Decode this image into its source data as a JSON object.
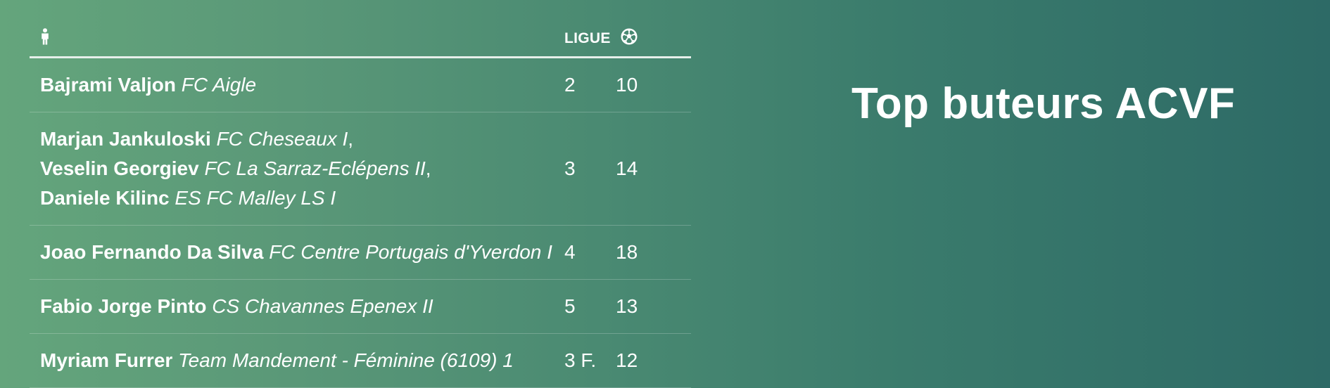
{
  "title": "Top buteurs ACVF",
  "table": {
    "headers": {
      "player_icon": "person-icon",
      "league": "LIGUE",
      "goals_icon": "soccer-ball-icon"
    },
    "rows": [
      {
        "scorers": [
          {
            "name": "Bajrami Valjon",
            "club": "FC Aigle"
          }
        ],
        "league": "2",
        "goals": "10"
      },
      {
        "scorers": [
          {
            "name": "Marjan Jankuloski",
            "club": "FC Cheseaux I"
          },
          {
            "name": "Veselin Georgiev",
            "club": "FC La Sarraz-Eclépens II"
          },
          {
            "name": "Daniele Kilinc",
            "club": "ES FC Malley LS I"
          }
        ],
        "league": "3",
        "goals": "14"
      },
      {
        "scorers": [
          {
            "name": "Joao Fernando Da Silva",
            "club": "FC Centre Portugais d'Yverdon I"
          }
        ],
        "league": "4",
        "goals": "18"
      },
      {
        "scorers": [
          {
            "name": "Fabio Jorge Pinto",
            "club": "CS Chavannes Epenex II"
          }
        ],
        "league": "5",
        "goals": "13"
      },
      {
        "scorers": [
          {
            "name": "Myriam Furrer",
            "club": "Team Mandement - Féminine (6109) 1"
          }
        ],
        "league": "3 F.",
        "goals": "12"
      }
    ]
  },
  "colors": {
    "background_start": "#64a57c",
    "background_end": "#2d6a66",
    "text": "#ffffff"
  }
}
